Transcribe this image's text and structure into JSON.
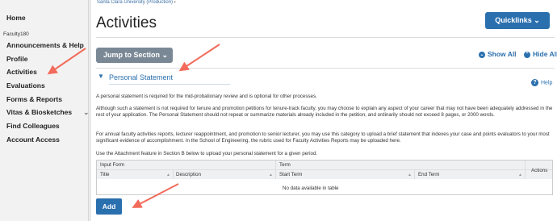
{
  "sidebar": {
    "items": [
      {
        "label": "Home"
      },
      {
        "label": "Faculty180"
      },
      {
        "label": "Announcements & Help"
      },
      {
        "label": "Profile"
      },
      {
        "label": "Activities"
      },
      {
        "label": "Evaluations"
      },
      {
        "label": "Forms & Reports"
      },
      {
        "label": "Vitas & Biosketches"
      },
      {
        "label": "Find Colleagues"
      },
      {
        "label": "Account Access"
      }
    ],
    "chevron": "⌄"
  },
  "header": {
    "breadcrumb": "Santa Clara University (Production)",
    "breadcrumb_sep": "›",
    "title": "Activities",
    "quicklinks_label": "Quicklinks"
  },
  "toolbar": {
    "jump_label": "Jump to Section",
    "show_all": "Show All",
    "separator": "|",
    "hide_all": "Hide All"
  },
  "section": {
    "title": "Personal Statement",
    "help": "Help",
    "paragraphs": [
      "A personal statement is required for the mid-probationary review and is optional for other processes.",
      "Although such a statement is not required for tenure and promotion petitions for tenure-track faculty, you may choose to explain any aspect of your career that may not have been adequately addressed in the rest of your application. The Personal Statement should not repeat or summarize materials already included in the petition, and ordinarily should not exceed 8 pages, or 2000 words.",
      "For annual faculty activities reports, lecturer reappointment, and promotion to senior lecturer, you may use this category to upload a brief statement that indexes your case and points evaluators to your most significant evidence of accomplishment. In the School of Engineering, the rubric used for Faculty Activities Reports may be uploaded here.",
      "Use the Attachment feature in Section B below to upload your personal statement for a given period."
    ]
  },
  "table": {
    "group_input": "Input Form",
    "group_term": "Term",
    "actions": "Actions",
    "columns": [
      "Title",
      "Description",
      "Start Term",
      "End Term"
    ],
    "empty": "No data available in table"
  },
  "add_label": "Add",
  "colors": {
    "accent": "#2a6fae",
    "annotation": "#f26b5b"
  }
}
